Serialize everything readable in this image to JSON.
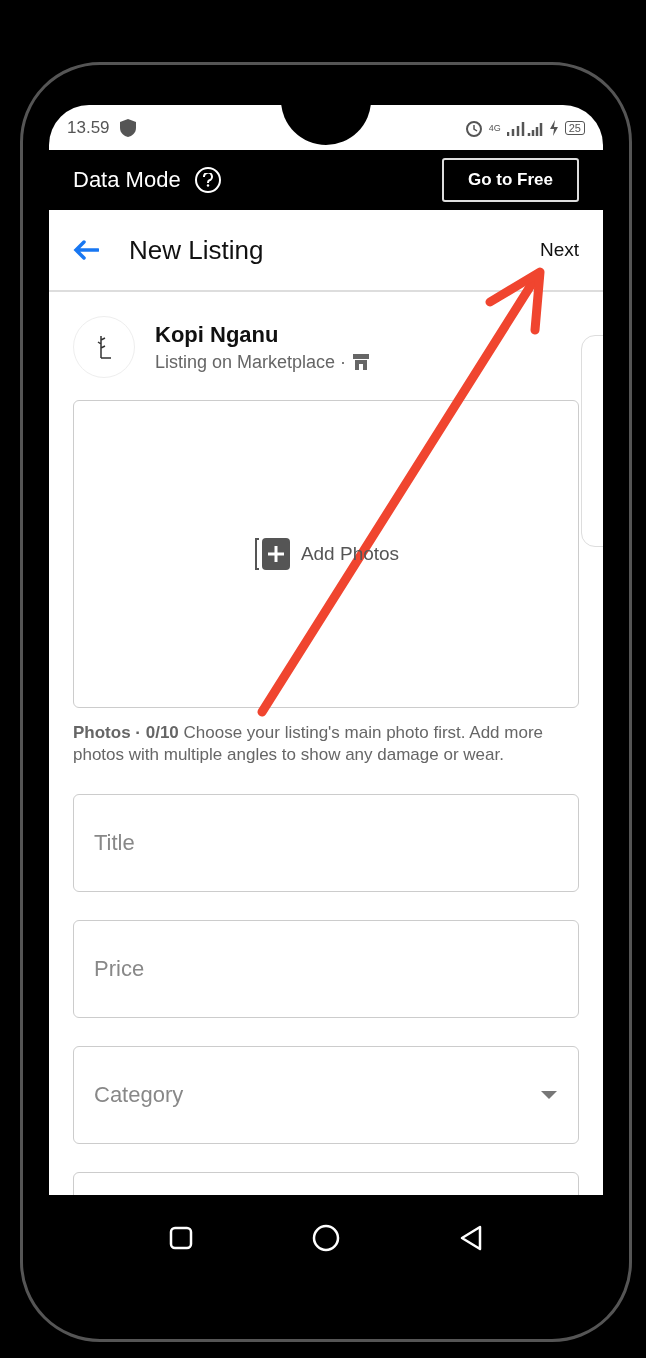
{
  "status_bar": {
    "time": "13.59",
    "network": "4G",
    "battery": "25"
  },
  "data_mode_bar": {
    "label": "Data Mode",
    "button": "Go to Free"
  },
  "header": {
    "title": "New Listing",
    "action": "Next"
  },
  "seller": {
    "name": "Kopi Nganu",
    "subtitle": "Listing on Marketplace ·"
  },
  "photos": {
    "button": "Add Photos",
    "caption": "**Photos · 0/10** Choose your listing's main photo first. Add more photos with multiple angles to show any damage or wear."
  },
  "fields": [
    {
      "kind": "text",
      "placeholder": "Title"
    },
    {
      "kind": "text",
      "placeholder": "Price"
    },
    {
      "kind": "dropdown",
      "placeholder": "Category"
    },
    {
      "kind": "text"
    }
  ],
  "annotation": {
    "kind": "arrow"
  }
}
